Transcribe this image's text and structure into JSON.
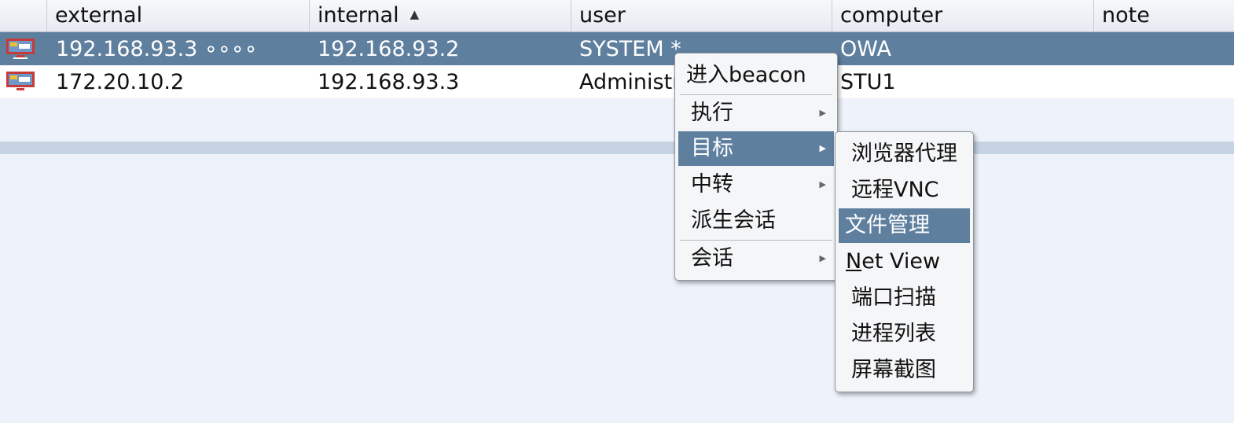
{
  "columns": [
    {
      "label": "external"
    },
    {
      "label": "internal",
      "sort_indicator": "▲"
    },
    {
      "label": "user"
    },
    {
      "label": "computer"
    },
    {
      "label": "note"
    }
  ],
  "rows": [
    {
      "external": "192.168.93.3 ∘∘∘∘",
      "internal": "192.168.93.2",
      "user": "SYSTEM *",
      "computer": "OWA",
      "note": "",
      "selected": true,
      "icon": "windows-monitor-icon"
    },
    {
      "external": "172.20.10.2",
      "internal": "192.168.93.3",
      "user": "Administrator",
      "computer": "STU1",
      "note": "",
      "selected": false,
      "icon": "windows-monitor-icon"
    }
  ],
  "context_menu": {
    "items": [
      {
        "label": "进入beacon"
      },
      {
        "label": "执行",
        "has_submenu": true
      },
      {
        "label": "目标",
        "has_submenu": true,
        "highlighted": true
      },
      {
        "label": "中转",
        "has_submenu": true
      },
      {
        "label": "派生会话"
      },
      {
        "label": "会话",
        "has_submenu": true
      }
    ]
  },
  "submenu": {
    "items": [
      {
        "label": "浏览器代理"
      },
      {
        "label": "远程VNC"
      },
      {
        "label": "文件管理",
        "highlighted": true
      },
      {
        "label_mnemonic": "N",
        "label_rest": "et View"
      },
      {
        "label": "端口扫描"
      },
      {
        "label": "进程列表"
      },
      {
        "label": "屏幕截图"
      }
    ]
  },
  "colors": {
    "selection": "#5f7f9f",
    "background": "#eef2fa",
    "splitter": "#c5d3e3"
  }
}
